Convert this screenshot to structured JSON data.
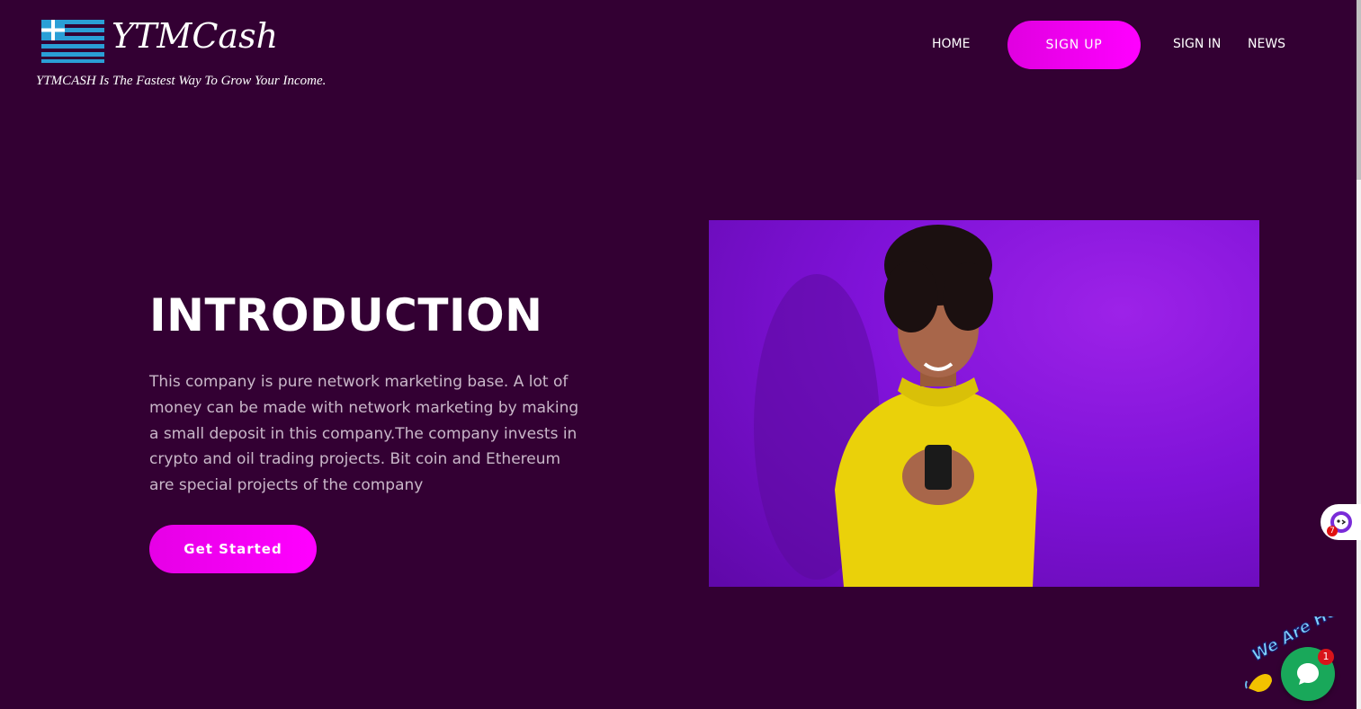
{
  "header": {
    "logo_text": "YTMCash",
    "tagline": "YTMCASH Is The Fastest Way To Grow Your Income."
  },
  "nav": {
    "home": "HOME",
    "signup": "SIGN UP",
    "signin": "SIGN IN",
    "news": "NEWS"
  },
  "hero": {
    "title": "INTRODUCTION",
    "text": "This company is pure network marketing base. A lot of money can be made with network marketing by making a small deposit in this company.The company invests in crypto and oil trading projects. Bit coin and Ethereum are special projects of the company",
    "cta_label": "Get Started",
    "image_icon": "woman-with-phone-photo"
  },
  "widgets": {
    "side_badge": "7",
    "chat_badge": "1",
    "sticker_text": "We Are Here!",
    "chat_icon": "chat-bubble-icon",
    "hand_icon": "waving-hand-icon"
  },
  "colors": {
    "background": "#330033",
    "accent": "#ff00ff",
    "image_bg": "#7f12d8",
    "chat_green": "#19a85a"
  }
}
